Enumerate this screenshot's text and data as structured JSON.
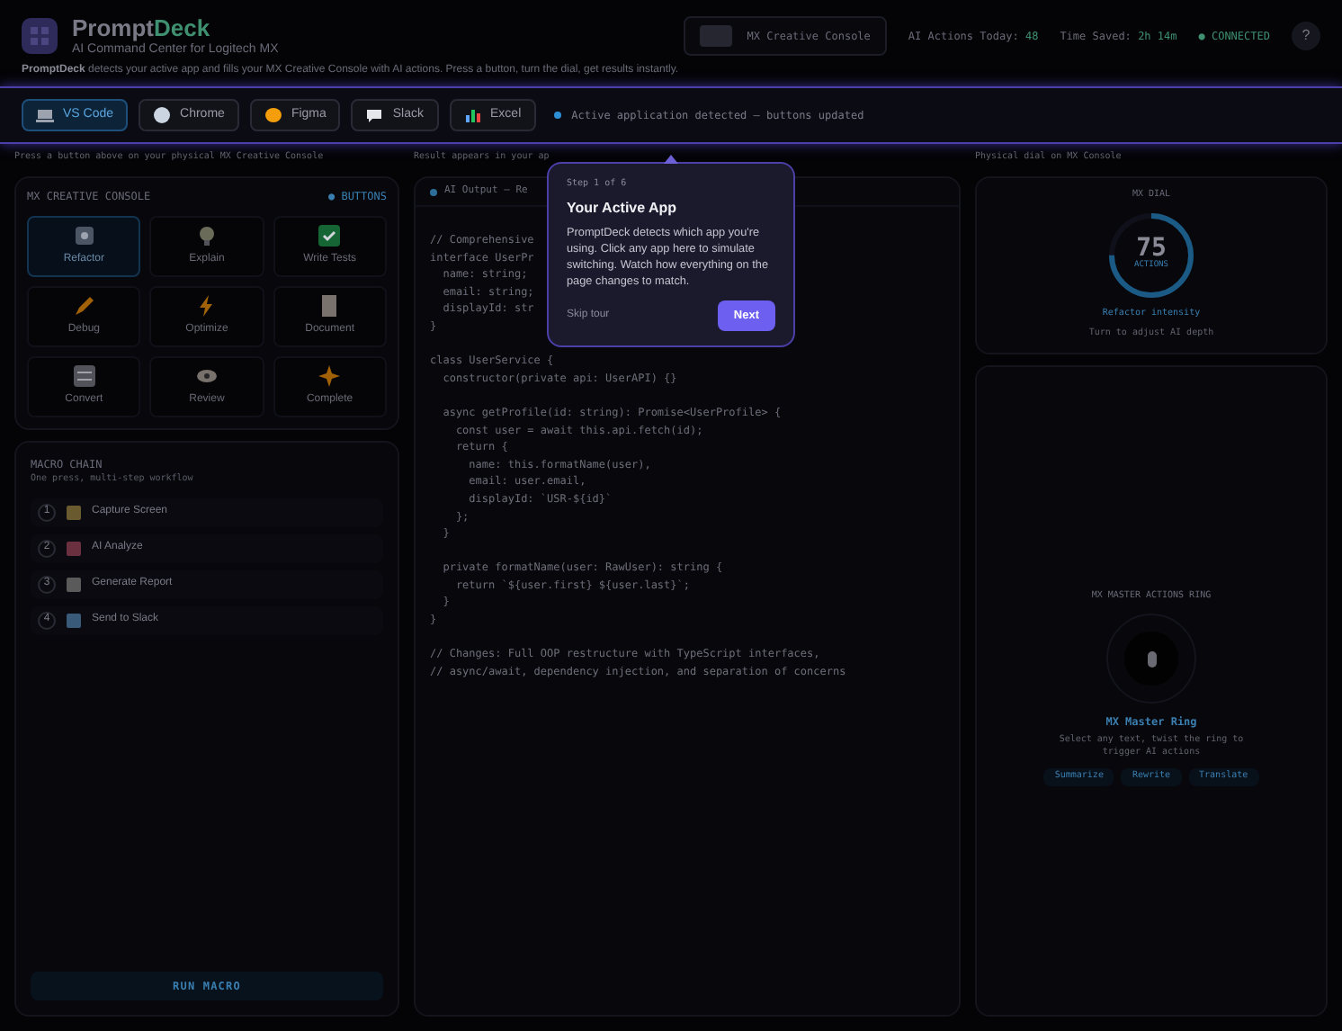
{
  "header": {
    "logo_primary": "Prompt",
    "logo_accent": "Deck",
    "subtitle": "AI Command Center for Logitech MX",
    "device": "MX Creative Console",
    "stats": [
      {
        "label": "AI Actions Today:",
        "value": "48"
      },
      {
        "label": "Time Saved:",
        "value": "2h 14m"
      }
    ],
    "status": "● CONNECTED",
    "help": "?"
  },
  "intro": "**PromptDeck** detects your active app and fills your MX Creative Console with AI actions. Press a button, turn the dial, get results instantly.",
  "apps": [
    {
      "label": "VS Code",
      "selected": true
    },
    {
      "label": "Chrome",
      "selected": false
    },
    {
      "label": "Figma",
      "selected": false
    },
    {
      "label": "Slack",
      "selected": false
    },
    {
      "label": "Excel",
      "selected": false
    }
  ],
  "app_status": "Active application detected — buttons updated",
  "console": {
    "caption": "Press a button above on your physical MX Creative Console",
    "title": "MX CREATIVE CONSOLE",
    "badge": "● BUTTONS",
    "buttons": [
      {
        "label": "Refactor",
        "selected": true
      },
      {
        "label": "Explain",
        "selected": false
      },
      {
        "label": "Write Tests",
        "selected": false
      },
      {
        "label": "Debug",
        "selected": false
      },
      {
        "label": "Optimize",
        "selected": false
      },
      {
        "label": "Document",
        "selected": false
      },
      {
        "label": "Convert",
        "selected": false
      },
      {
        "label": "Review",
        "selected": false
      },
      {
        "label": "Complete",
        "selected": false
      }
    ]
  },
  "macro": {
    "title": "MACRO CHAIN",
    "subtitle": "One press, multi-step workflow",
    "steps": [
      {
        "number": "1",
        "label": "Capture Screen"
      },
      {
        "number": "2",
        "label": "AI Analyze"
      },
      {
        "number": "3",
        "label": "Generate Report"
      },
      {
        "number": "4",
        "label": "Send to Slack"
      }
    ],
    "run": "RUN MACRO"
  },
  "output": {
    "caption": "Result appears in your ap",
    "title": "AI Output — Re",
    "code_blocks": [
      [
        "// Comprehensive",
        "interface UserPr",
        "  name: string;",
        "  email: string;",
        "  displayId: str",
        "}"
      ],
      [
        "class UserService {",
        "  constructor(private api: UserAPI) {}"
      ],
      [
        "  async getProfile(id: string): Promise<UserProfile> {",
        "    const user = await this.api.fetch(id);",
        "    return {",
        "      name: this.formatName(user),",
        "      email: user.email,",
        "      displayId: `USR-${id}`",
        "    };",
        "  }"
      ],
      [
        "  private formatName(user: RawUser): string {",
        "    return `${user.first} ${user.last}`;",
        "  }",
        "}"
      ],
      [
        "// Changes: Full OOP restructure with TypeScript interfaces,",
        "// async/await, dependency injection, and separation of concerns"
      ]
    ]
  },
  "dial": {
    "caption": "Physical dial on MX Console",
    "title": "MX DIAL",
    "value": "75",
    "unit": "ACTIONS",
    "level": 0.75,
    "label": "Refactor intensity",
    "hint": "Turn to adjust AI depth"
  },
  "ring": {
    "title": "MX MASTER ACTIONS RING",
    "name": "MX Master Ring",
    "hint": "Select any text, twist the ring to trigger AI actions",
    "actions": [
      "Summarize",
      "Rewrite",
      "Translate"
    ]
  },
  "tour": {
    "step": "Step 1 of 6",
    "title": "Your Active App",
    "body": "PromptDeck detects which app you're using. Click any app here to simulate switching. Watch how everything on the page changes to match.",
    "skip": "Skip tour",
    "next": "Next"
  }
}
